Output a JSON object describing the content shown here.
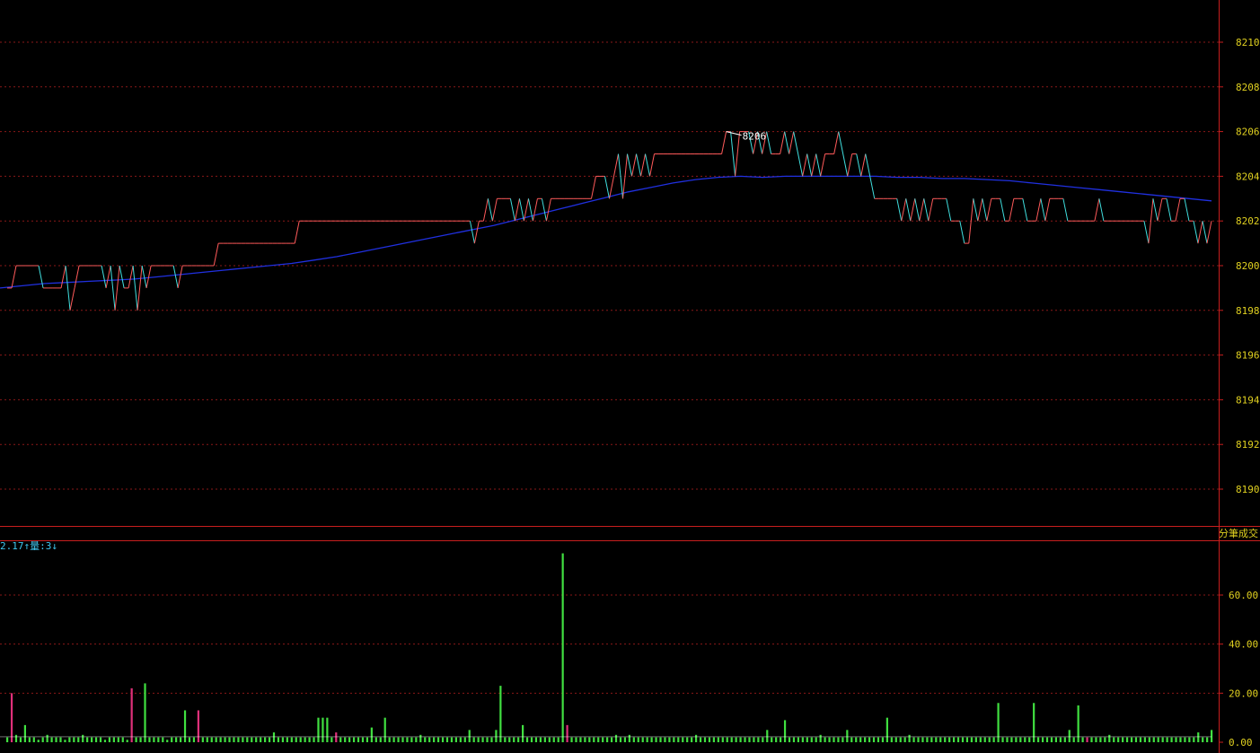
{
  "colors": {
    "background": "#000000",
    "frame": "#c81e1e",
    "grid": "#8a1818",
    "price_up": "#ff5a5a",
    "price_down": "#40e0e0",
    "avg_line": "#2030e0",
    "vol_up": "#e0307a",
    "vol_down": "#40e040",
    "axis_text": "#e0d020",
    "legend_text": "#40c8f0",
    "peak_text": "#ffffff"
  },
  "panels": {
    "volume_title": "分筆成交",
    "volume_legend": "2.17↑量:3↓",
    "peak_label": "8206"
  },
  "chart_data": [
    {
      "type": "line",
      "title": "",
      "xlabel": "",
      "ylabel": "",
      "ylim": [
        8188,
        8212
      ],
      "yticks": [
        8190,
        8192,
        8194,
        8196,
        8198,
        8200,
        8202,
        8204,
        8206,
        8208,
        8210
      ],
      "grid": true,
      "series": [
        {
          "values": [
            8199,
            8199,
            8200,
            8200,
            8200,
            8200,
            8200,
            8200,
            8199,
            8199,
            8199,
            8199,
            8199,
            8200,
            8198,
            8199,
            8200,
            8200,
            8200,
            8200,
            8200,
            8200,
            8199,
            8200,
            8198,
            8200,
            8199,
            8199,
            8200,
            8198,
            8200,
            8199,
            8200,
            8200,
            8200,
            8200,
            8200,
            8200,
            8199,
            8200,
            8200,
            8200,
            8200,
            8200,
            8200,
            8200,
            8200,
            8201,
            8201,
            8201,
            8201,
            8201,
            8201,
            8201,
            8201,
            8201,
            8201,
            8201,
            8201,
            8201,
            8201,
            8201,
            8201,
            8201,
            8201,
            8202,
            8202,
            8202,
            8202,
            8202,
            8202,
            8202,
            8202,
            8202,
            8202,
            8202,
            8202,
            8202,
            8202,
            8202,
            8202,
            8202,
            8202,
            8202,
            8202,
            8202,
            8202,
            8202,
            8202,
            8202,
            8202,
            8202,
            8202,
            8202,
            8202,
            8202,
            8202,
            8202,
            8202,
            8202,
            8202,
            8202,
            8202,
            8202,
            8201,
            8202,
            8202,
            8203,
            8202,
            8203,
            8203,
            8203,
            8203,
            8202,
            8203,
            8202,
            8203,
            8202,
            8203,
            8203,
            8202,
            8203,
            8203,
            8203,
            8203,
            8203,
            8203,
            8203,
            8203,
            8203,
            8203,
            8204,
            8204,
            8204,
            8203,
            8204,
            8205,
            8203,
            8205,
            8204,
            8205,
            8204,
            8205,
            8204,
            8205,
            8205,
            8205,
            8205,
            8205,
            8205,
            8205,
            8205,
            8205,
            8205,
            8205,
            8205,
            8205,
            8205,
            8205,
            8205,
            8206,
            8206,
            8204,
            8206,
            8206,
            8206,
            8205,
            8206,
            8205,
            8206,
            8205,
            8205,
            8205,
            8206,
            8205,
            8206,
            8205,
            8204,
            8205,
            8204,
            8205,
            8204,
            8205,
            8205,
            8205,
            8206,
            8205,
            8204,
            8205,
            8205,
            8204,
            8205,
            8204,
            8203,
            8203,
            8203,
            8203,
            8203,
            8203,
            8202,
            8203,
            8202,
            8203,
            8202,
            8203,
            8202,
            8203,
            8203,
            8203,
            8203,
            8202,
            8202,
            8202,
            8201,
            8201,
            8203,
            8202,
            8203,
            8202,
            8203,
            8203,
            8203,
            8202,
            8202,
            8203,
            8203,
            8203,
            8202,
            8202,
            8202,
            8203,
            8202,
            8203,
            8203,
            8203,
            8203,
            8202,
            8202,
            8202,
            8202,
            8202,
            8202,
            8202,
            8203,
            8202,
            8202,
            8202,
            8202,
            8202,
            8202,
            8202,
            8202,
            8202,
            8202,
            8201,
            8203,
            8202,
            8203,
            8203,
            8202,
            8202,
            8203,
            8203,
            8202,
            8202,
            8201,
            8202,
            8201,
            8202
          ],
          "color_up": "#ff5a5a",
          "color_down": "#40e0e0"
        },
        {
          "values": [
            8199.0,
            8199.1,
            8199.2,
            8199.25,
            8199.3,
            8199.35,
            8199.4,
            8199.5,
            8199.6,
            8199.7,
            8199.8,
            8199.9,
            8200.0,
            8200.1,
            8200.25,
            8200.4,
            8200.6,
            8200.8,
            8201.0,
            8201.2,
            8201.4,
            8201.6,
            8201.8,
            8202.05,
            8202.3,
            8202.55,
            8202.8,
            8203.05,
            8203.3,
            8203.5,
            8203.7,
            8203.85,
            8203.95,
            8204.0,
            8203.95,
            8204.0,
            8204.0,
            8204.0,
            8204.0,
            8204.0,
            8203.95,
            8203.95,
            8203.9,
            8203.9,
            8203.85,
            8203.8,
            8203.7,
            8203.6,
            8203.5,
            8203.4,
            8203.3,
            8203.2,
            8203.1,
            8203.0,
            8202.9
          ],
          "color": "#2030e0"
        }
      ]
    },
    {
      "type": "bar",
      "title": "分筆成交",
      "ylim": [
        0,
        80
      ],
      "yticks": [
        0,
        20,
        40,
        60
      ],
      "grid": true,
      "values": [
        2,
        20,
        3,
        2,
        7,
        2,
        2,
        1,
        2,
        3,
        2,
        2,
        2,
        1,
        2,
        2,
        2,
        3,
        2,
        2,
        2,
        2,
        1,
        2,
        2,
        2,
        2,
        1,
        22,
        2,
        2,
        24,
        2,
        2,
        2,
        2,
        1,
        2,
        2,
        2,
        13,
        2,
        2,
        13,
        2,
        2,
        2,
        2,
        2,
        2,
        2,
        2,
        2,
        2,
        2,
        2,
        2,
        2,
        2,
        2,
        4,
        2,
        2,
        2,
        2,
        2,
        2,
        2,
        2,
        2,
        10,
        10,
        10,
        2,
        4,
        2,
        2,
        2,
        2,
        2,
        2,
        2,
        6,
        2,
        2,
        10,
        2,
        2,
        2,
        2,
        2,
        2,
        2,
        3,
        2,
        2,
        2,
        2,
        2,
        2,
        2,
        2,
        2,
        2,
        5,
        2,
        2,
        2,
        2,
        2,
        5,
        23,
        2,
        2,
        2,
        2,
        7,
        2,
        2,
        2,
        2,
        2,
        2,
        2,
        2,
        77,
        7,
        2,
        2,
        2,
        2,
        2,
        2,
        2,
        2,
        2,
        2,
        3,
        2,
        2,
        3,
        2,
        2,
        2,
        2,
        2,
        2,
        2,
        2,
        2,
        2,
        2,
        2,
        2,
        2,
        3,
        2,
        2,
        2,
        2,
        2,
        2,
        2,
        2,
        2,
        2,
        2,
        2,
        2,
        2,
        2,
        5,
        2,
        2,
        2,
        9,
        2,
        2,
        2,
        2,
        2,
        2,
        2,
        3,
        2,
        2,
        2,
        2,
        2,
        5,
        2,
        2,
        2,
        2,
        2,
        2,
        2,
        2,
        10,
        2,
        2,
        2,
        2,
        3,
        2,
        2,
        2,
        2,
        2,
        2,
        2,
        2,
        2,
        2,
        2,
        2,
        2,
        2,
        2,
        2,
        2,
        2,
        2,
        16,
        2,
        2,
        2,
        2,
        2,
        2,
        2,
        16,
        2,
        2,
        2,
        2,
        2,
        2,
        2,
        5,
        2,
        15,
        2,
        2,
        2,
        2,
        2,
        2,
        3,
        2,
        2,
        2,
        2,
        2,
        2,
        2,
        2,
        2,
        2,
        2,
        2,
        2,
        2,
        2,
        2,
        2,
        2,
        2,
        4,
        2,
        2,
        5
      ],
      "up_flags": [
        0,
        1,
        0,
        0,
        0,
        0,
        0,
        0,
        0,
        0,
        0,
        0,
        0,
        0,
        0,
        0,
        0,
        0,
        0,
        0,
        0,
        0,
        0,
        0,
        0,
        0,
        0,
        0,
        1,
        0,
        0,
        0,
        0,
        0,
        0,
        0,
        0,
        0,
        0,
        0,
        0,
        0,
        0,
        1,
        0,
        0,
        0,
        0,
        0,
        0,
        0,
        0,
        0,
        0,
        0,
        0,
        0,
        0,
        0,
        0,
        0,
        0,
        0,
        0,
        0,
        0,
        0,
        0,
        0,
        0,
        0,
        0,
        0,
        0,
        1,
        0,
        0,
        0,
        0,
        0,
        0,
        0,
        0,
        0,
        0,
        0,
        0,
        0,
        0,
        0,
        0,
        0,
        0,
        0,
        0,
        0,
        0,
        0,
        0,
        0,
        0,
        0,
        0,
        0,
        0,
        0,
        0,
        0,
        0,
        0,
        0,
        0,
        0,
        0,
        0,
        0,
        0,
        0,
        0,
        0,
        0,
        0,
        0,
        0,
        0,
        0,
        1,
        0,
        0,
        0,
        0,
        0,
        0,
        0,
        0,
        0,
        0,
        0,
        0,
        0,
        0,
        0,
        0,
        0,
        0,
        0,
        0,
        0,
        0,
        0,
        0,
        0,
        0,
        0,
        0,
        0,
        0,
        0,
        0,
        0,
        0,
        0,
        0,
        0,
        0,
        0,
        0,
        0,
        0,
        0,
        0,
        0,
        0,
        0,
        0,
        0,
        0,
        0,
        0,
        0,
        0,
        0,
        0,
        0,
        0,
        0,
        0,
        0,
        0,
        0,
        0,
        0,
        0,
        0,
        0,
        0,
        0,
        0,
        0,
        0,
        0,
        0,
        0,
        0,
        0,
        0,
        0,
        0,
        0,
        0,
        0,
        0,
        0,
        0,
        0,
        0,
        0,
        0,
        0,
        0,
        0,
        0,
        0,
        0,
        0,
        0,
        0,
        0,
        0,
        0,
        0,
        0,
        0,
        0,
        0,
        0,
        0,
        0,
        0,
        0,
        0,
        0,
        0,
        1,
        0,
        0,
        0,
        0,
        0,
        0,
        0,
        0,
        0,
        0,
        0,
        0,
        0,
        0,
        0,
        0,
        0,
        0,
        0,
        0,
        0,
        0,
        0,
        0,
        0,
        0,
        0,
        0,
        0,
        0
      ]
    }
  ]
}
